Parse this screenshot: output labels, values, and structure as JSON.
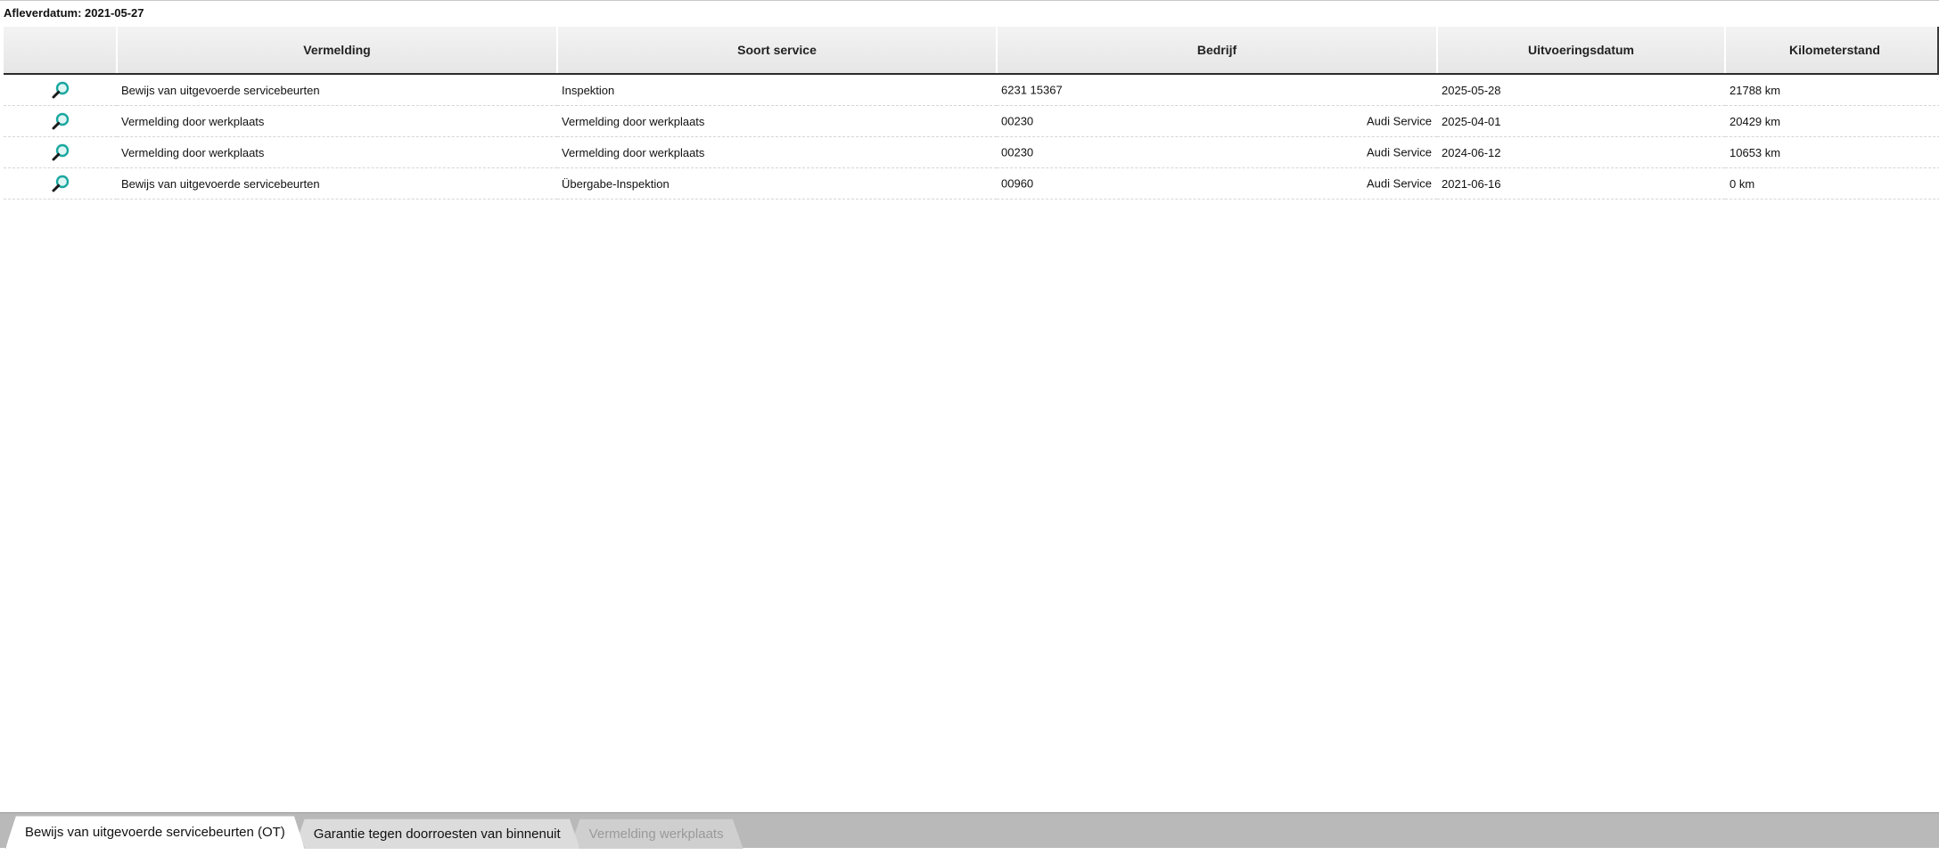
{
  "header": {
    "delivery_date": "Afleverdatum: 2021-05-27"
  },
  "table": {
    "columns": {
      "action": "",
      "vermelding": "Vermelding",
      "soort": "Soort service",
      "bedrijf": "Bedrijf",
      "datum": "Uitvoeringsdatum",
      "km": "Kilometerstand"
    },
    "rows": [
      {
        "icon": "magnifier-icon",
        "vermelding": "Bewijs van uitgevoerde servicebeurten",
        "soort": "Inspektion",
        "bedrijf_nummer": "6231 15367",
        "bedrijf_naam": "",
        "datum": "2025-05-28",
        "km": "21788 km"
      },
      {
        "icon": "magnifier-icon",
        "vermelding": "Vermelding door werkplaats",
        "soort": "Vermelding door werkplaats",
        "bedrijf_nummer": "00230",
        "bedrijf_naam": "Audi Service",
        "datum": "2025-04-01",
        "km": "20429 km"
      },
      {
        "icon": "magnifier-icon",
        "vermelding": "Vermelding door werkplaats",
        "soort": "Vermelding door werkplaats",
        "bedrijf_nummer": "00230",
        "bedrijf_naam": "Audi Service",
        "datum": "2024-06-12",
        "km": "10653 km"
      },
      {
        "icon": "magnifier-icon",
        "vermelding": "Bewijs van uitgevoerde servicebeurten",
        "soort": "Übergabe-Inspektion",
        "bedrijf_nummer": "00960",
        "bedrijf_naam": "Audi Service",
        "datum": "2021-06-16",
        "km": "0 km"
      }
    ]
  },
  "tabs": [
    {
      "label": "Bewijs van uitgevoerde servicebeurten (OT)",
      "state": "active"
    },
    {
      "label": "Garantie tegen doorroesten van binnenuit",
      "state": "inactive"
    },
    {
      "label": "Vermelding werkplaats",
      "state": "disabled"
    }
  ],
  "colors": {
    "icon_lens": "#1aa7a0",
    "icon_handle": "#1b1b1b",
    "tabbar": "#b9b9b9",
    "header_border": "#2b2b2b",
    "disabled_text": "#9a9a9a"
  }
}
